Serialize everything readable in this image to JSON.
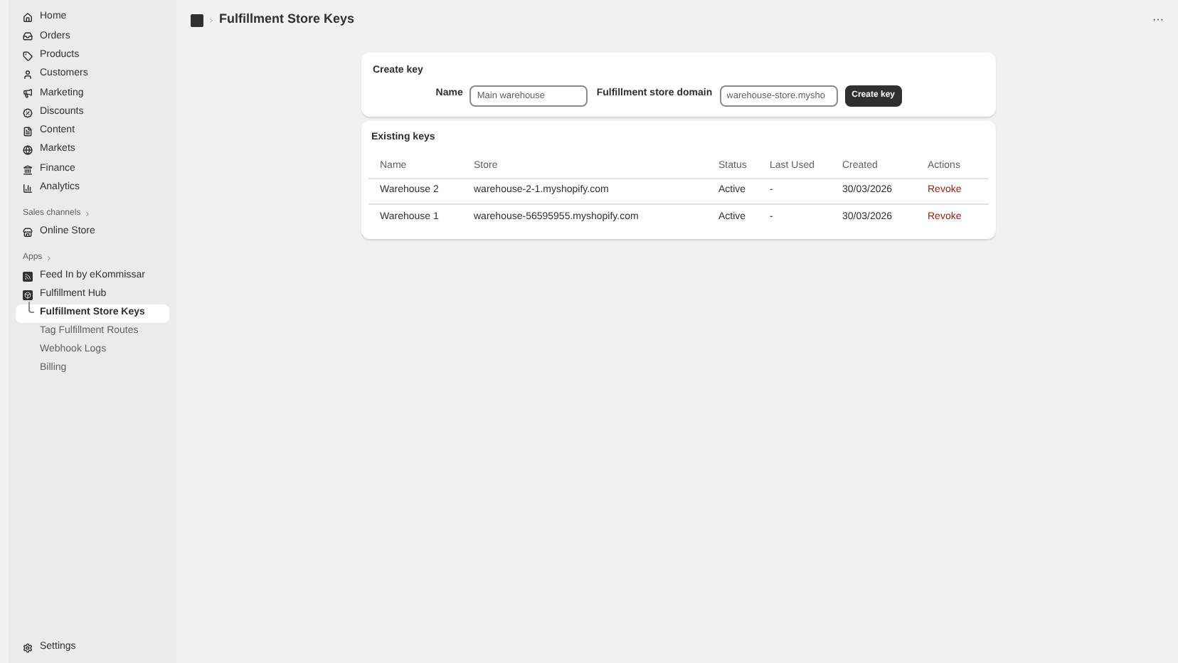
{
  "sidebar": {
    "items": [
      {
        "label": "Home",
        "selected": false
      },
      {
        "label": "Orders",
        "selected": false
      },
      {
        "label": "Products",
        "selected": false
      },
      {
        "label": "Customers",
        "selected": false
      },
      {
        "label": "Marketing",
        "selected": false
      },
      {
        "label": "Discounts",
        "selected": false
      },
      {
        "label": "Content",
        "selected": false
      },
      {
        "label": "Markets",
        "selected": false
      },
      {
        "label": "Finance",
        "selected": false
      },
      {
        "label": "Analytics",
        "selected": false
      }
    ],
    "sales_channels": {
      "heading": "Sales channels",
      "items": [
        {
          "label": "Online Store"
        }
      ]
    },
    "apps": {
      "heading": "Apps",
      "items": [
        {
          "label": "Feed In by eKommissar"
        },
        {
          "label": "Fulfillment Hub",
          "children": [
            {
              "label": "Fulfillment Store Keys",
              "selected": true
            },
            {
              "label": "Tag Fulfillment Routes",
              "selected": false
            },
            {
              "label": "Webhook Logs",
              "selected": false
            },
            {
              "label": "Billing",
              "selected": false
            }
          ]
        }
      ]
    },
    "settings": "Settings"
  },
  "header": {
    "title": "Fulfillment Store Keys",
    "menu": "···"
  },
  "create_key": {
    "title": "Create key",
    "name_label": "Name",
    "name_placeholder": "Main warehouse",
    "domain_label": "Fulfillment store domain",
    "domain_placeholder": "warehouse-store.mysho",
    "button": "Create key"
  },
  "existing_keys": {
    "title": "Existing keys",
    "columns": [
      "Name",
      "Store",
      "Status",
      "Last Used",
      "Created",
      "Actions"
    ],
    "rows": [
      {
        "name": "Warehouse 2",
        "store": "warehouse-2-1.myshopify.com",
        "status": "Active",
        "last_used": "-",
        "created": "30/03/2026",
        "action": "Revoke"
      },
      {
        "name": "Warehouse 1",
        "store": "warehouse-56595955.myshopify.com",
        "status": "Active",
        "last_used": "-",
        "created": "30/03/2026",
        "action": "Revoke"
      }
    ]
  }
}
